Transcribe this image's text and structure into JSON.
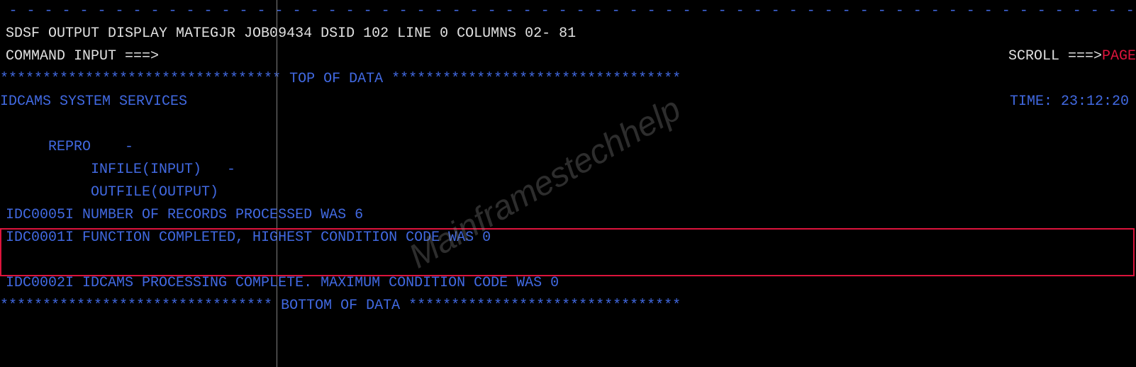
{
  "header": {
    "dashes": " - - - - - - - - - - - - - - - - - - - - - - - - - - - - - - - - - - - - - - - - - - - - - - - - - - - - - - - - - - - - - - - - - -",
    "title": " SDSF OUTPUT DISPLAY MATEGJR  JOB09434  DSID   102 LINE 0       COLUMNS 02- 81",
    "command_label": " COMMAND INPUT ===>",
    "scroll_label": "SCROLL ===> ",
    "scroll_value": "PAGE"
  },
  "top_marker": {
    "stars_left": "********************************* ",
    "label": "TOP OF DATA",
    "stars_right": " **********************************"
  },
  "services": {
    "text": "IDCAMS  SYSTEM SERVICES",
    "time_label": "TIME: ",
    "time_value": "23:12:20"
  },
  "body": {
    "repro": "     REPRO    -",
    "infile": "          INFILE(INPUT)   -",
    "outfile": "          OUTFILE(OUTPUT)",
    "msg1": "IDC0005I NUMBER OF RECORDS PROCESSED WAS 6",
    "msg2": "IDC0001I FUNCTION COMPLETED, HIGHEST CONDITION CODE WAS 0",
    "msg3": "IDC0002I IDCAMS PROCESSING COMPLETE. MAXIMUM CONDITION CODE WAS 0"
  },
  "bottom_marker": {
    "stars_left": "******************************** ",
    "label": "BOTTOM OF DATA",
    "stars_right": " ********************************"
  },
  "watermark": "Mainframestechhelp"
}
